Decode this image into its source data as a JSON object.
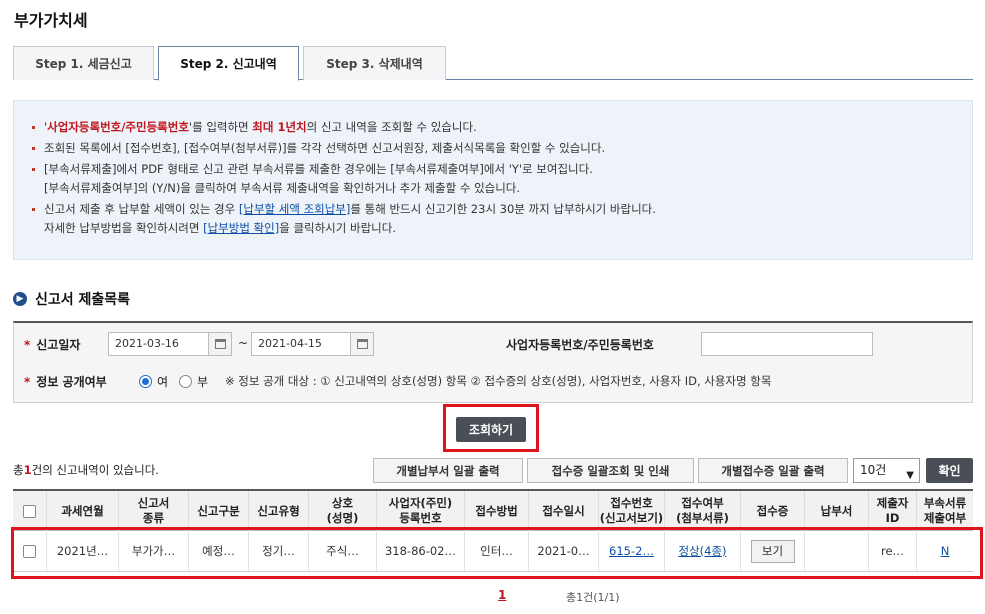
{
  "page": {
    "title": "부가가치세"
  },
  "tabs": [
    {
      "label": "Step 1. 세금신고",
      "active": false
    },
    {
      "label": "Step 2. 신고내역",
      "active": true
    },
    {
      "label": "Step 3. 삭제내역",
      "active": false
    }
  ],
  "info": {
    "l1_a": "'",
    "l1_b": "사업자등록번호/주민등록번호",
    "l1_c": "'를 입력하면 ",
    "l1_d": "최대 1년치",
    "l1_e": "의 신고 내역을 조회할 수 있습니다.",
    "l2": "조회된 목록에서 [접수번호], [접수여부(첨부서류)]를 각각 선택하면 신고서원장, 제출서식목록을 확인할 수 있습니다.",
    "l3": "[부속서류제출]에서 PDF 형태로 신고 관련 부속서류를 제출한 경우에는 [부속서류제출여부]에서 'Y'로 보여집니다.",
    "l3b": "[부속서류제출여부]의 (Y/N)을 클릭하여 부속서류 제출내역을 확인하거나 추가 제출할 수 있습니다.",
    "l4_a": "신고서 제출 후 납부할 세액이 있는 경우 ",
    "l4_link": "[납부할 세액 조회납부]",
    "l4_b": "를 통해 반드시 신고기한 23시 30분 까지 납부하시기 바랍니다.",
    "l5_a": "자세한 납부방법을 확인하시려면 ",
    "l5_link": "[납부방법 확인]",
    "l5_b": "을 클릭하시기 바랍니다."
  },
  "section": {
    "title": "신고서 제출목록"
  },
  "search": {
    "date_label": "신고일자",
    "date_from": "2021-03-16",
    "date_to": "2021-04-15",
    "tilde": "~",
    "bizno_label": "사업자등록번호/주민등록번호",
    "bizno_value": "",
    "disclose_label": "정보 공개여부",
    "radio_yes": "여",
    "radio_no": "부",
    "radio_selected": "여",
    "note": "※ 정보 공개 대상 : ① 신고내역의 상호(성명) 항목 ② 접수증의 상호(성명), 사업자번호, 사용자 ID, 사용자명 항목",
    "button": "조회하기"
  },
  "results": {
    "count_prefix": "총",
    "count": "1",
    "count_suffix": "건의 신고내역이 있습니다.",
    "btn_bulk_pay": "개별납부서 일괄 출력",
    "btn_bulk_receipt": "접수증 일괄조회 및 인쇄",
    "btn_bulk_receipt_print": "개별접수증 일괄 출력",
    "page_size": "10건",
    "btn_confirm": "확인"
  },
  "table": {
    "headers": {
      "period": "과세연월",
      "type1": "신고서",
      "type2": "종류",
      "category": "신고구분",
      "kind": "신고유형",
      "name1": "상호",
      "name2": "(성명)",
      "bizno1": "사업자(주민)",
      "bizno2": "등록번호",
      "method": "접수방법",
      "date": "접수일시",
      "recno1": "접수번호",
      "recno2": "(신고서보기)",
      "status1": "접수여부",
      "status2": "(첨부서류)",
      "receipt": "접수증",
      "paybill": "납부서",
      "submitter1": "제출자",
      "submitter2": "ID",
      "attach1": "부속서류",
      "attach2": "제출여부"
    },
    "rows": [
      {
        "period": "2021년…",
        "type": "부가가…",
        "category": "예정…",
        "kind": "정기…",
        "name": "주식…",
        "bizno": "318-86-02…",
        "method": "인터…",
        "date": "2021-0…",
        "recno": "615-2…",
        "status": "정상(4종)",
        "receipt_btn": "보기",
        "paybill": "",
        "submitter": "re…",
        "attach": "N"
      }
    ]
  },
  "pager": {
    "current": "1",
    "total": "총1건(1/1)"
  }
}
